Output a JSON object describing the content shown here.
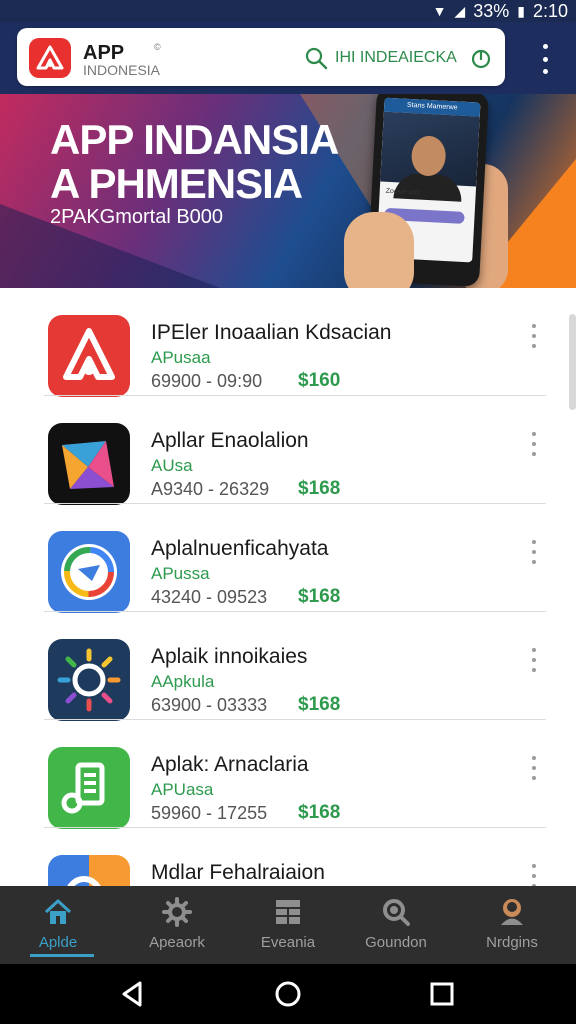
{
  "status_bar": {
    "battery": "33%",
    "time": "2:10"
  },
  "header": {
    "brand_line1": "APP",
    "brand_line2": "INDONESIA",
    "brand_mark": "©",
    "search_value": "IHI INDEAIECKA"
  },
  "banner": {
    "title_line1": "APP INDANSIA",
    "title_line2": "A PHMENSIA",
    "subtitle": "2PAKGmortal B000",
    "phone_header": "Stans Mamerwe",
    "phone_caption": "Zoosie ann"
  },
  "apps": [
    {
      "name": "IPEler Inoaalian Kdsacian",
      "publisher": "APusaa",
      "meta": "69900 -  09:90",
      "price": "$160",
      "icon": "red-app-icon",
      "color": "#e53935"
    },
    {
      "name": "Apllar Enaolalion",
      "publisher": "AUsa",
      "meta": "A9340 -  26329",
      "price": "$168",
      "icon": "kite-app-icon",
      "color": "#111111"
    },
    {
      "name": "Aplalnuenficahyata",
      "publisher": "APussa",
      "meta": "43240 -  09523",
      "price": "$168",
      "icon": "circle-app-icon",
      "color": "#3d7de0"
    },
    {
      "name": "Aplaik innoikaies",
      "publisher": "AApkula",
      "meta": "63900 -  03333",
      "price": "$168",
      "icon": "sun-app-icon",
      "color": "#1e3a5c"
    },
    {
      "name": "Aplak: Arnaclaria",
      "publisher": "APUasa",
      "meta": "59960 -  17255",
      "price": "$168",
      "icon": "green-app-icon",
      "color": "#43b649"
    },
    {
      "name": "Mdlar Fehalraiaion",
      "publisher": "",
      "meta": "",
      "price": "",
      "icon": "google-app-icon",
      "color": "#3d7de0"
    }
  ],
  "bottom_nav": [
    {
      "label": "Aplde",
      "icon": "home-icon",
      "active": true
    },
    {
      "label": "Apeaork",
      "icon": "gear-icon",
      "active": false
    },
    {
      "label": "Eveania",
      "icon": "grid-icon",
      "active": false
    },
    {
      "label": "Goundon",
      "icon": "search-icon",
      "active": false
    },
    {
      "label": "Nrdgins",
      "icon": "profile-icon",
      "active": false
    }
  ],
  "colors": {
    "header": "#1d2d5e",
    "accent": "#2e9a4d",
    "active_tab": "#3aa0c8",
    "brand_red": "#e8312f"
  }
}
